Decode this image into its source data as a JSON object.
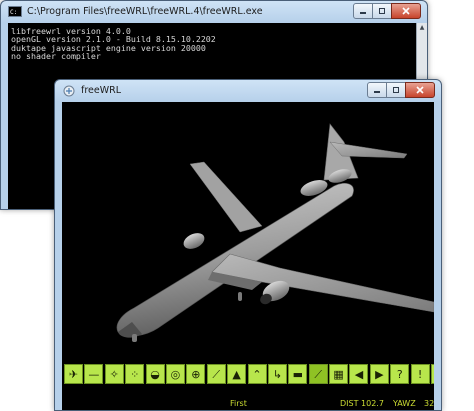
{
  "console_window": {
    "title": "C:\\Program Files\\freeWRL\\freeWRL.4\\freeWRL.exe",
    "icon": "cmd-icon",
    "lines": [
      "libfreewrl version 4.0.0",
      "openGL version 2.1.0 - Build 8.15.10.2202",
      "duktape javascript engine version 20000",
      "no shader compiler"
    ]
  },
  "freewrl_window": {
    "title": "freeWRL",
    "icon": "freewrl-icon"
  },
  "toolbar": {
    "buttons": [
      {
        "name": "walk-icon",
        "glyph": "✈"
      },
      {
        "name": "fly-icon",
        "glyph": "—"
      },
      {
        "name": "examine-icon",
        "glyph": "✧"
      },
      {
        "name": "explore-icon",
        "glyph": "⁘"
      },
      {
        "name": "spherical-icon",
        "glyph": "◒"
      },
      {
        "name": "turntable-icon",
        "glyph": "◎"
      },
      {
        "name": "lookat-icon",
        "glyph": "⊕"
      },
      {
        "name": "dist-icon",
        "glyph": "⟋"
      },
      {
        "name": "up-arrow-icon",
        "glyph": "▲"
      },
      {
        "name": "level-icon",
        "glyph": "⌃"
      },
      {
        "name": "headlight-icon",
        "glyph": "↳"
      },
      {
        "name": "collision-icon",
        "glyph": "▬"
      },
      {
        "name": "pick-icon",
        "glyph": "⟋"
      },
      {
        "name": "grid-icon",
        "glyph": "▦"
      },
      {
        "name": "prev-viewpoint-icon",
        "glyph": "◀"
      },
      {
        "name": "next-viewpoint-icon",
        "glyph": "▶"
      },
      {
        "name": "help-icon",
        "glyph": "?"
      },
      {
        "name": "alert-icon",
        "glyph": "!"
      },
      {
        "name": "check-icon",
        "glyph": "☑"
      }
    ],
    "viewpoint_label": "First",
    "dist_text": "DIST 102.7",
    "mode_text": "YAWZ",
    "fps_text": "32"
  },
  "colors": {
    "toolbar_green": "#b8e64c",
    "status_yellow": "#ccdd33",
    "model_grey": "#9a9a9a"
  }
}
